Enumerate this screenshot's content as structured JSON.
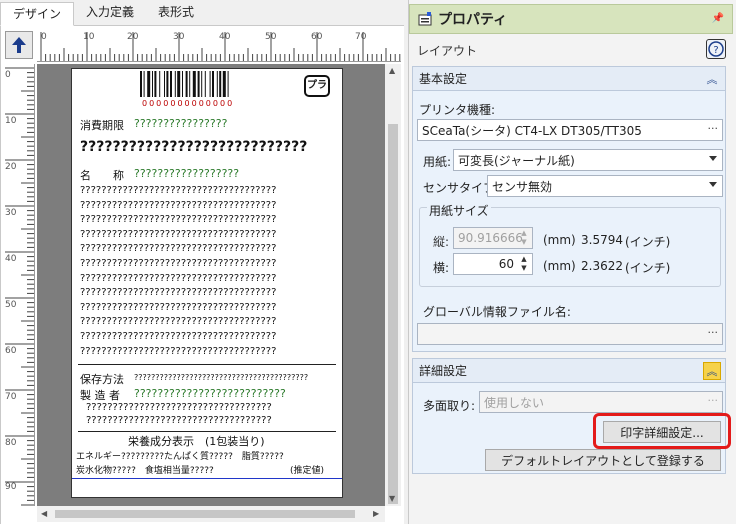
{
  "tabs": [
    "デザイン",
    "入力定義",
    "表形式"
  ],
  "ruler": {
    "h_ticks": [
      "0",
      "10",
      "20",
      "30",
      "40",
      "50",
      "60",
      "70"
    ],
    "v_ticks": [
      "0",
      "10",
      "20",
      "30",
      "40",
      "50",
      "60",
      "70",
      "80",
      "90"
    ]
  },
  "label": {
    "barcode_digits": "0000000000000",
    "expiry_label": "消費期限",
    "expiry_value": "????????????????",
    "big_title": "????????????????????????????",
    "name_label": "名　　称",
    "name_value": "??????????????????",
    "ingredients_lines": [
      "?????????????????????????????????????",
      "?????????????????????????????????????",
      "?????????????????????????????????????",
      "?????????????????????????????????????",
      "?????????????????????????????????????",
      "?????????????????????????????????????",
      "?????????????????????????????????????",
      "?????????????????????????????????????",
      "?????????????????????????????????????",
      "?????????????????????????????????????",
      "?????????????????????????????????????",
      "?????????????????????????????????????"
    ],
    "storage_label": "保存方法",
    "storage_value": "?????????????????????????????????????????",
    "maker_label": "製 造 者",
    "maker_value_1": "??????????????????????????",
    "maker_value_2": "???????????????????????????????????",
    "maker_value_3": "???????????????????????????????????",
    "nutrition_title": "栄養成分表示　(1包装当り)",
    "nutrition_line1": "エネルギー?????????たんぱく質?????　脂質?????",
    "nutrition_line2": "炭水化物?????　食塩相当量?????",
    "estimate": "(推定値)"
  },
  "panel": {
    "title": "プロパティ",
    "subtitle": "レイアウト",
    "basic_section": "基本設定",
    "printer_label": "プリンタ機種:",
    "printer_value": "SCeaTa(シータ) CT4-LX DT305/TT305",
    "paper_label": "用紙:",
    "paper_value": "可変長(ジャーナル紙)",
    "sensor_label": "センサタイプ:",
    "sensor_value": "センサ無効",
    "size_group": "用紙サイズ",
    "height_label": "縦:",
    "height_value": "90.916666",
    "height_unit": "(mm)",
    "height_inch": "3.5794",
    "height_inch_unit": "(インチ)",
    "width_label": "横:",
    "width_value": "60",
    "width_unit": "(mm)",
    "width_inch": "2.3622",
    "width_inch_unit": "(インチ)",
    "global_label": "グローバル情報ファイル名:",
    "global_value": "",
    "detail_section": "詳細設定",
    "multi_label": "多面取り:",
    "multi_value": "使用しない",
    "print_detail_btn": "印字詳細設定...",
    "default_btn": "デフォルトレイアウトとして登録する"
  },
  "colors": {
    "header_bg": "#d7e4bd",
    "highlight": "#e31b1b",
    "accent_yellow": "#f6d24a"
  }
}
